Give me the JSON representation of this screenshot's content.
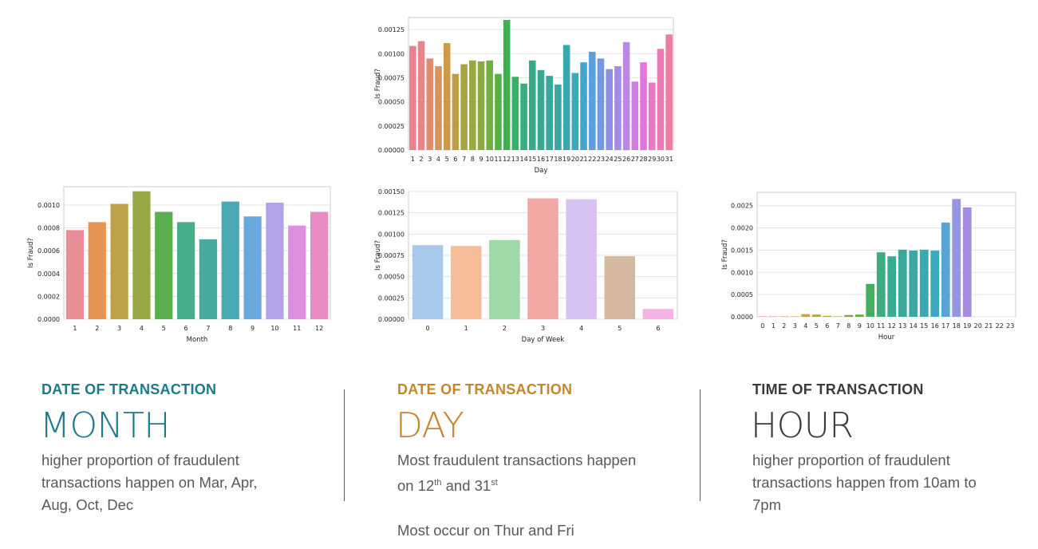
{
  "colors": {
    "month_accent": "#1a7a8c",
    "day_accent": "#c8842b",
    "hour_accent": "#3a3a3a",
    "divider": "#2b6b7b",
    "text": "#595959"
  },
  "sections": {
    "month": {
      "kicker": "DATE OF TRANSACTION",
      "title": "MONTH",
      "desc": "higher proportion of fraudulent transactions happen on Mar, Apr, Aug, Oct, Dec"
    },
    "day": {
      "kicker": "DATE OF TRANSACTION",
      "title": "DAY",
      "desc_line1_a": "Most fraudulent transactions happen",
      "desc_line1_b": "on 12",
      "sup1": "th",
      "and": " and 31",
      "sup2": "st",
      "desc_line2": "Most occur on Thur and Fri"
    },
    "hour": {
      "kicker": "TIME OF TRANSACTION",
      "title": "HOUR",
      "desc": "higher proportion of fraudulent transactions happen from 10am to 7pm"
    }
  },
  "chart_data": [
    {
      "id": "day",
      "type": "bar",
      "xlabel": "Day",
      "ylabel": "Is Fraud?",
      "ylim": [
        0,
        0.001375
      ],
      "yticks": [
        "0.00000",
        "0.00025",
        "0.00050",
        "0.00075",
        "0.00100",
        "0.00125"
      ],
      "grid": true,
      "categories": [
        "1",
        "2",
        "3",
        "4",
        "5",
        "6",
        "7",
        "8",
        "9",
        "10",
        "11",
        "12",
        "13",
        "14",
        "15",
        "16",
        "17",
        "18",
        "19",
        "20",
        "21",
        "22",
        "23",
        "24",
        "25",
        "26",
        "27",
        "28",
        "29",
        "30",
        "31"
      ],
      "values": [
        0.00108,
        0.00113,
        0.00095,
        0.00087,
        0.00111,
        0.00079,
        0.00089,
        0.00093,
        0.00092,
        0.00093,
        0.00079,
        0.00135,
        0.00076,
        0.00069,
        0.00093,
        0.00083,
        0.00077,
        0.00068,
        0.00109,
        0.0008,
        0.00091,
        0.00102,
        0.00095,
        0.00084,
        0.00087,
        0.00112,
        0.00071,
        0.00091,
        0.0007,
        0.00105,
        0.0012
      ],
      "colors": [
        "#e8828f",
        "#e8848a",
        "#e38a6c",
        "#d8935a",
        "#cc9a48",
        "#bb9f45",
        "#aba341",
        "#9ba73f",
        "#89ab3f",
        "#72ae40",
        "#52b342",
        "#3bb24f",
        "#38b06c",
        "#37ae7d",
        "#37ab88",
        "#38a991",
        "#39a89a",
        "#3aa6a3",
        "#3ca6ae",
        "#3da7bc",
        "#43a5cc",
        "#5b9ed9",
        "#7597e1",
        "#8b8fe5",
        "#a58be6",
        "#bc85e6",
        "#d17ce2",
        "#e276d8",
        "#ea76c8",
        "#ec78b5",
        "#ec7ca0"
      ]
    },
    {
      "id": "month",
      "type": "bar",
      "xlabel": "Month",
      "ylabel": "Is Fraud?",
      "ylim": [
        0,
        0.00116
      ],
      "yticks": [
        "0.0000",
        "0.0002",
        "0.0004",
        "0.0006",
        "0.0008",
        "0.0010"
      ],
      "grid": true,
      "categories": [
        "1",
        "2",
        "3",
        "4",
        "5",
        "6",
        "7",
        "8",
        "9",
        "10",
        "11",
        "12"
      ],
      "values": [
        0.00078,
        0.00085,
        0.00101,
        0.00112,
        0.00094,
        0.00085,
        0.0007,
        0.00103,
        0.0009,
        0.00102,
        0.00082,
        0.00094
      ],
      "colors": [
        "#e98d99",
        "#e59453",
        "#bda14a",
        "#98a845",
        "#5aaf4f",
        "#47ae8a",
        "#48aba0",
        "#4aa8b5",
        "#6aa9dd",
        "#b1a3e5",
        "#e18de0",
        "#e88bc3"
      ]
    },
    {
      "id": "dow",
      "type": "bar",
      "xlabel": "Day of Week",
      "ylabel": "Is Fraud?",
      "ylim": [
        0,
        0.0015
      ],
      "yticks": [
        "0.00000",
        "0.00025",
        "0.00050",
        "0.00075",
        "0.00100",
        "0.00125",
        "0.00150"
      ],
      "grid": true,
      "categories": [
        "0",
        "1",
        "2",
        "3",
        "4",
        "5",
        "6"
      ],
      "values": [
        0.00087,
        0.00086,
        0.00093,
        0.00142,
        0.00141,
        0.00074,
        0.00012
      ],
      "colors": [
        "#a8c8ec",
        "#f4bc98",
        "#9ed8a6",
        "#f2a8a2",
        "#d8c2f4",
        "#d5b8a0",
        "#f3b4e4"
      ]
    },
    {
      "id": "hour",
      "type": "bar",
      "xlabel": "Hour",
      "ylabel": "Is Fraud?",
      "ylim": [
        0,
        0.0028
      ],
      "yticks": [
        "0.0000",
        "0.0005",
        "0.0010",
        "0.0015",
        "0.0020",
        "0.0025"
      ],
      "grid": true,
      "categories": [
        "0",
        "1",
        "2",
        "3",
        "4",
        "5",
        "6",
        "7",
        "8",
        "9",
        "10",
        "11",
        "12",
        "13",
        "14",
        "15",
        "16",
        "17",
        "18",
        "19",
        "20",
        "21",
        "22",
        "23"
      ],
      "values": [
        1e-05,
        1e-05,
        1e-05,
        1e-05,
        6e-05,
        5e-05,
        2e-05,
        1e-05,
        4e-05,
        5e-05,
        0.00074,
        0.00145,
        0.00136,
        0.00151,
        0.00149,
        0.00151,
        0.00149,
        0.00212,
        0.00265,
        0.00246,
        0.0,
        0.0,
        0.0,
        0.0
      ],
      "colors": [
        "#e48a8f",
        "#e08f73",
        "#d99a5c",
        "#cfa251",
        "#c4a34a",
        "#b7a245",
        "#a9a342",
        "#98a541",
        "#85a841",
        "#6aab44",
        "#44ae5f",
        "#3bad80",
        "#3aab91",
        "#3aa99b",
        "#3ba8a6",
        "#3ca8b2",
        "#3eaac2",
        "#5aa4d4",
        "#9496e4",
        "#a78ce5",
        "#c48ae4",
        "#d988d8",
        "#e286c4",
        "#e687b0"
      ]
    }
  ]
}
